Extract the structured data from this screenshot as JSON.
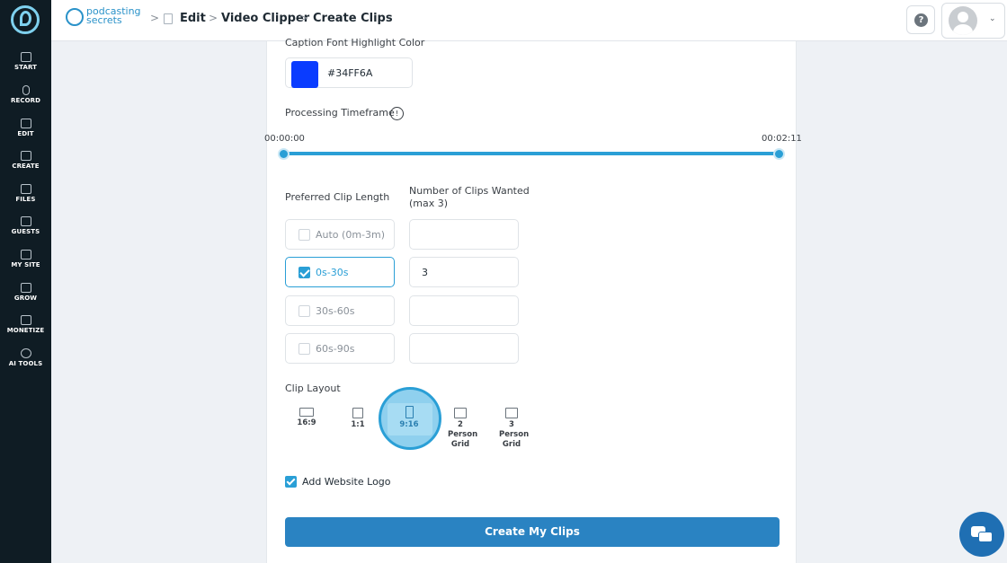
{
  "sidebar": {
    "items": [
      {
        "label": "START"
      },
      {
        "label": "RECORD"
      },
      {
        "label": "EDIT"
      },
      {
        "label": "CREATE"
      },
      {
        "label": "FILES"
      },
      {
        "label": "GUESTS"
      },
      {
        "label": "MY SITE"
      },
      {
        "label": "GROW"
      },
      {
        "label": "MONETIZE"
      },
      {
        "label": "AI TOOLS"
      }
    ]
  },
  "topbar": {
    "brand_line1": "podcasting",
    "brand_line2": "secrets",
    "breadcrumbs": [
      "Edit",
      "Video Clipper",
      "Create Clips"
    ],
    "help_symbol": "?"
  },
  "form": {
    "caption_color_label": "Caption Font Highlight Color",
    "caption_color_value": "#34FF6A",
    "swatch_color": "#0a3cff",
    "timeframe_label": "Processing Timeframe",
    "timeframe_info": "!",
    "timeframe_start": "00:00:00",
    "timeframe_end": "00:02:11",
    "timeframe_start_fraction": 0,
    "timeframe_end_fraction": 1,
    "clip_length_label": "Preferred Clip Length",
    "num_clips_label": "Number of Clips Wanted (max 3)",
    "clip_options": [
      {
        "label": "Auto (0m-3m)",
        "checked": false,
        "count": ""
      },
      {
        "label": "0s-30s",
        "checked": true,
        "count": "3"
      },
      {
        "label": "30s-60s",
        "checked": false,
        "count": ""
      },
      {
        "label": "60s-90s",
        "checked": false,
        "count": ""
      }
    ],
    "layout_label": "Clip Layout",
    "layouts": [
      {
        "label": "16:9"
      },
      {
        "label": "1:1"
      },
      {
        "label": "9:16",
        "selected": true
      },
      {
        "label": "2 Person Grid"
      },
      {
        "label": "3 Person Grid"
      }
    ],
    "website_logo_label": "Add Website Logo",
    "website_logo_checked": true,
    "submit_label": "Create My Clips"
  },
  "colors": {
    "accent": "#2a9fd6",
    "button": "#2a83c2",
    "sidebar_bg": "#0f1c24"
  }
}
